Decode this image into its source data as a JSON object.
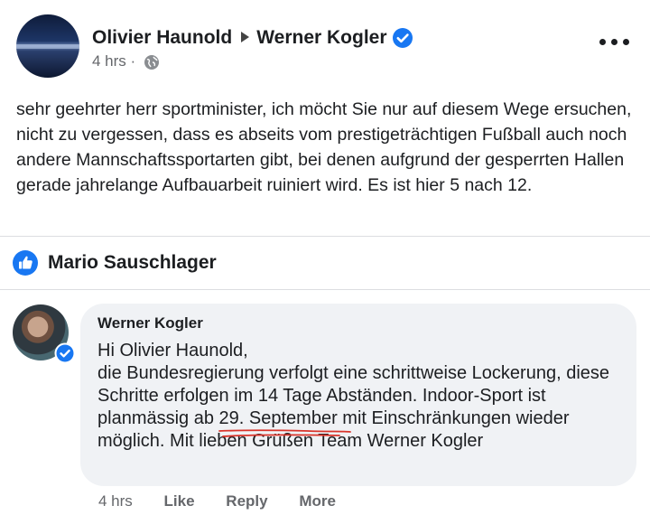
{
  "post": {
    "author": "Olivier Haunold",
    "target": "Werner Kogler",
    "time": "4 hrs",
    "separator": "·",
    "text": "sehr geehrter herr sportminister, ich möcht Sie nur auf diesem Wege ersuchen, nicht zu vergessen, dass es abseits vom prestigeträchtigen Fußball auch noch andere Mannschaftssportarten gibt, bei denen aufgrund der gesperrten Hallen gerade jahrelange Aufbauarbeit ruiniert wird. Es ist hier 5 nach 12."
  },
  "reaction": {
    "name": "Mario Sauschlager",
    "icon": "like-icon"
  },
  "comment": {
    "author": "Werner Kogler",
    "line1": "Hi Olivier Haunold,",
    "line2": "die Bundesregierung verfolgt eine schrittweise Lockerung, diese Schritte erfolgen im 14 Tage Abständen. Indoor-Sport ist planmässig ab ",
    "date": "29. September",
    "line3": " mit Einschränkungen wieder möglich. Mit lieben Grüßen Team Werner Kogler",
    "time": "4 hrs",
    "actions": {
      "like": "Like",
      "reply": "Reply",
      "more": "More"
    }
  },
  "colors": {
    "accent": "#1877f2",
    "bubble": "#f0f2f5",
    "meta": "#65676b",
    "underline": "#d9342b"
  }
}
